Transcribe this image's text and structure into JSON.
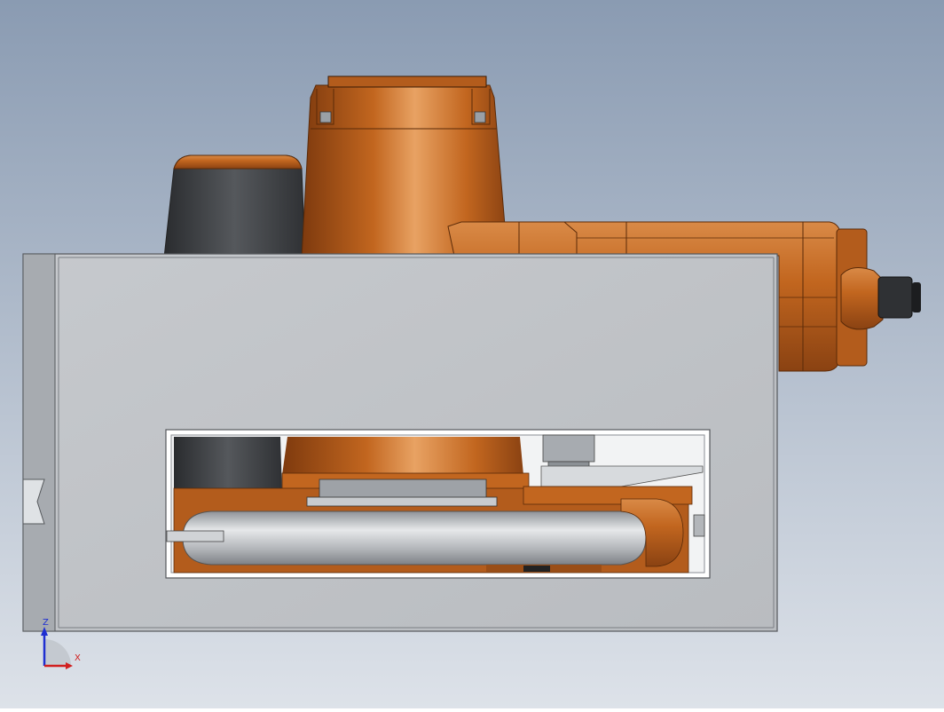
{
  "viewport": {
    "background_top": "#8a9bb2",
    "background_bottom": "#dde2e9",
    "colors": {
      "housing": "#c1c4c8",
      "housing_edge": "#55585c",
      "robot_orange": "#c2661f",
      "robot_orange_light": "#e39a5b",
      "robot_orange_dark": "#7e3a0e",
      "rubber_black": "#3b3d41",
      "tube_grey": "#b8bbbf"
    }
  },
  "triad": {
    "z_label": "Z",
    "x_label": "X",
    "z_color": "#1f2fd1",
    "x_color": "#d11f1f"
  }
}
